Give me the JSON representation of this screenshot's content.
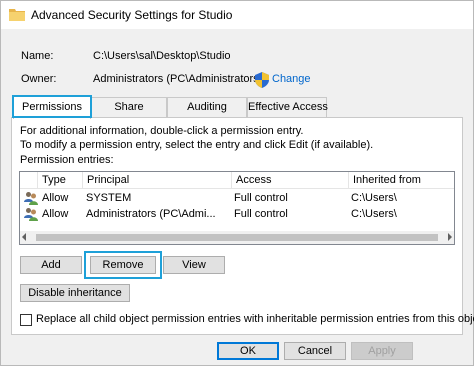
{
  "window": {
    "title": "Advanced Security Settings for Studio"
  },
  "summary": {
    "name_label": "Name:",
    "name_value": "C:\\Users\\sal\\Desktop\\Studio",
    "owner_label": "Owner:",
    "owner_value": "Administrators (PC\\Administrators)",
    "change_link": "Change"
  },
  "tabs": [
    {
      "label": "Permissions",
      "active": true
    },
    {
      "label": "Share",
      "active": false
    },
    {
      "label": "Auditing",
      "active": false
    },
    {
      "label": "Effective Access",
      "active": false
    }
  ],
  "permissions": {
    "info_line_1": "For additional information, double-click a permission entry.",
    "info_line_2": "To modify a permission entry, select the entry and click Edit (if available).",
    "entries_label": "Permission entries:",
    "columns": [
      "Type",
      "Principal",
      "Access",
      "Inherited from"
    ],
    "rows": [
      {
        "type": "Allow",
        "principal": "SYSTEM",
        "access": "Full control",
        "inherited_from": "C:\\Users\\"
      },
      {
        "type": "Allow",
        "principal": "Administrators (PC\\Admi...",
        "access": "Full control",
        "inherited_from": "C:\\Users\\"
      }
    ],
    "buttons": {
      "add": "Add",
      "remove": "Remove",
      "view": "View",
      "disable_inheritance": "Disable inheritance"
    },
    "replace_checkbox_label": "Replace all child object permission entries with inheritable permission entries from this object",
    "replace_checked": false
  },
  "footer": {
    "ok": "OK",
    "cancel": "Cancel",
    "apply": "Apply"
  },
  "colors": {
    "highlight": "#1ea0d8",
    "link": "#0066cc",
    "default_button_border": "#0078d7"
  },
  "icons": {
    "title": "folder-icon",
    "owner": "uac-shield-icon",
    "entry": "users-icon"
  }
}
